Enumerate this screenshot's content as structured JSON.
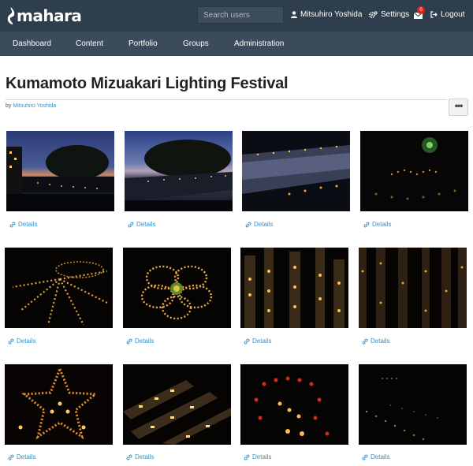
{
  "header": {
    "logo_text": "mahara",
    "search_placeholder": "Search users",
    "user_name": "Mitsuhiro Yoshida",
    "settings_label": "Settings",
    "inbox_count": "0",
    "logout_label": "Logout"
  },
  "nav": {
    "items": [
      "Dashboard",
      "Content",
      "Portfolio",
      "Groups",
      "Administration"
    ]
  },
  "page": {
    "title": "Kumamoto Mizuakari Lighting Festival",
    "by_prefix": "by",
    "author": "Mitsuhiro Yoshida",
    "more_label": "•••"
  },
  "gallery": {
    "details_label": "Details",
    "photos": [
      {
        "scene": "dusk-river-trees"
      },
      {
        "scene": "dusk-river-wide"
      },
      {
        "scene": "night-river-reflection"
      },
      {
        "scene": "dark-lanterns-green-light"
      },
      {
        "scene": "lantern-rays"
      },
      {
        "scene": "lantern-flower"
      },
      {
        "scene": "bamboo-lanterns"
      },
      {
        "scene": "bamboo-lanterns-wide"
      },
      {
        "scene": "lantern-star"
      },
      {
        "scene": "lantern-boards"
      },
      {
        "scene": "red-lanterns"
      },
      {
        "scene": "dark-night-lanterns"
      }
    ]
  },
  "colors": {
    "header_bg": "#2f3e4c",
    "nav_bg": "#3b4b5b",
    "link": "#3a8fc2",
    "badge": "#d9251d"
  }
}
